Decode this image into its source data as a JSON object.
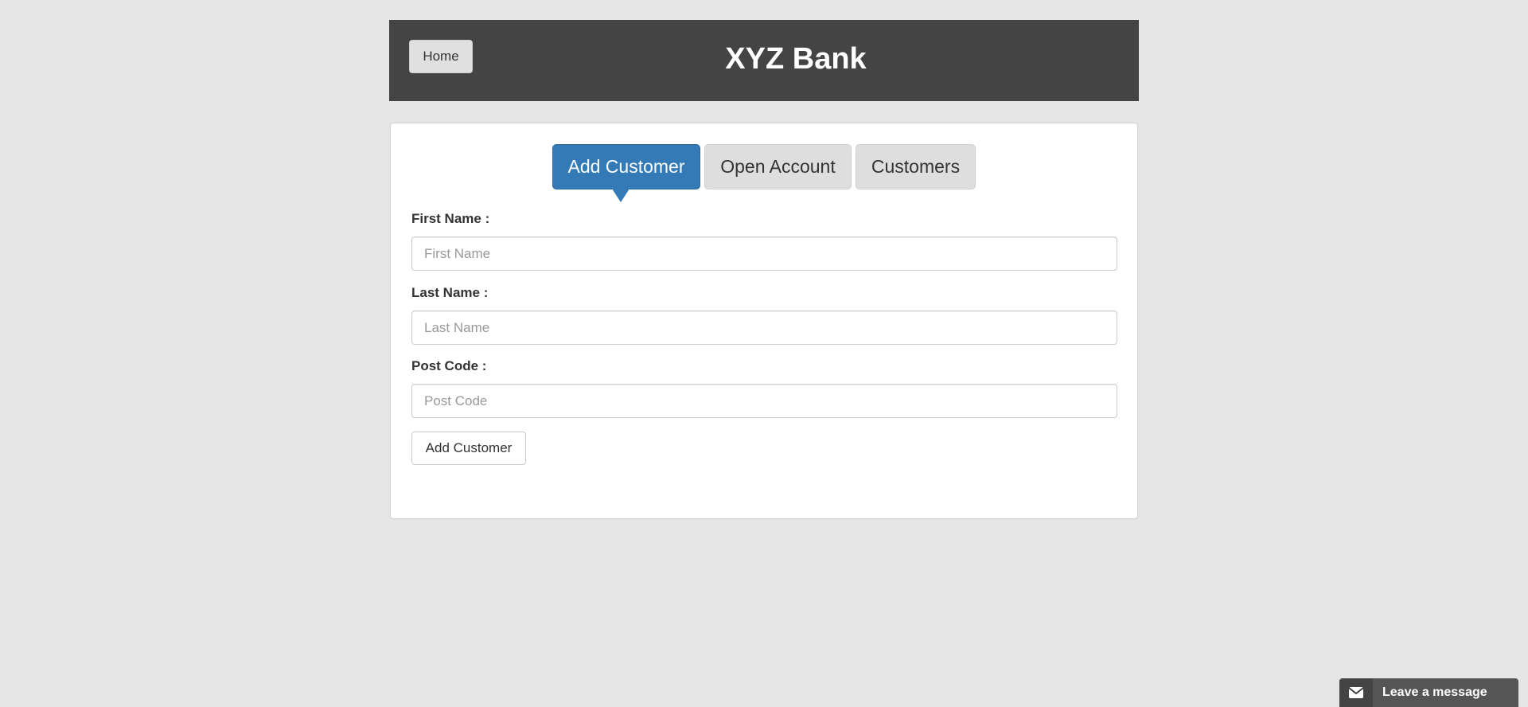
{
  "header": {
    "home_label": "Home",
    "title": "XYZ Bank",
    "background_color": "#444444"
  },
  "tabs": [
    {
      "label": "Add Customer",
      "active": true
    },
    {
      "label": "Open Account",
      "active": false
    },
    {
      "label": "Customers",
      "active": false
    }
  ],
  "form": {
    "first_name": {
      "label": "First Name :",
      "placeholder": "First Name",
      "value": ""
    },
    "last_name": {
      "label": "Last Name :",
      "placeholder": "Last Name",
      "value": ""
    },
    "post_code": {
      "label": "Post Code :",
      "placeholder": "Post Code",
      "value": ""
    },
    "submit_label": "Add Customer"
  },
  "chat_widget": {
    "icon": "envelope-icon",
    "label": "Leave a message"
  },
  "colors": {
    "page_background": "#e6e6e6",
    "accent": "#337ab7",
    "tab_inactive": "#dedede",
    "chat_widget": "#555555"
  }
}
